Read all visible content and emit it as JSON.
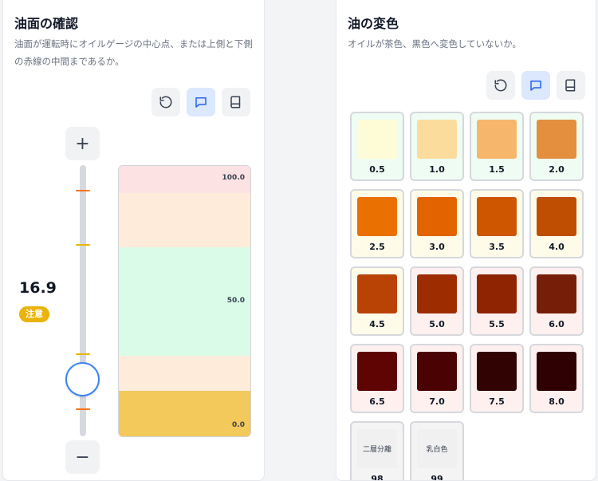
{
  "left": {
    "title": "油面の確認",
    "description": "油面が運転時にオイルゲージの中心点、または上側と下側の赤線の中間まであるか。",
    "value": "16.9",
    "status": "注意",
    "status_color": "#eab308",
    "level_fraction": 0.169,
    "gauge": {
      "top_label": "100.0",
      "mid_label": "50.0",
      "bottom_label": "0.0"
    },
    "stepper": {
      "plus": "+",
      "minus": "−"
    }
  },
  "right": {
    "title": "油の変色",
    "description": "オイルが茶色、黒色へ変色していないか。",
    "swatches": [
      {
        "label": "0.5",
        "color": "#fefcd7",
        "bg": "#eefcf3"
      },
      {
        "label": "1.0",
        "color": "#fbdc9c",
        "bg": "#eefcf3"
      },
      {
        "label": "1.5",
        "color": "#f6b66c",
        "bg": "#eefcf3"
      },
      {
        "label": "2.0",
        "color": "#e38f3d",
        "bg": "#eefcf3"
      },
      {
        "label": "2.5",
        "color": "#ea7002",
        "bg": "#fefbe9"
      },
      {
        "label": "3.0",
        "color": "#e26300",
        "bg": "#fefbe9"
      },
      {
        "label": "3.5",
        "color": "#cf5600",
        "bg": "#fefbe9"
      },
      {
        "label": "4.0",
        "color": "#bf4e02",
        "bg": "#fefbe9"
      },
      {
        "label": "4.5",
        "color": "#b94304",
        "bg": "#fefbe9"
      },
      {
        "label": "5.0",
        "color": "#9d2c01",
        "bg": "#fdf0ef"
      },
      {
        "label": "5.5",
        "color": "#8e2401",
        "bg": "#fdf0ef"
      },
      {
        "label": "6.0",
        "color": "#771e08",
        "bg": "#fdf0ef"
      },
      {
        "label": "6.5",
        "color": "#5e0504",
        "bg": "#fdf0ef"
      },
      {
        "label": "7.0",
        "color": "#4b0202",
        "bg": "#fdf0ef"
      },
      {
        "label": "7.5",
        "color": "#310303",
        "bg": "#fdf0ef"
      },
      {
        "label": "8.0",
        "color": "#2f0102",
        "bg": "#fdf0ef"
      },
      {
        "label": "98",
        "chip_text": "二層分離",
        "color": "#f0f0f0",
        "bg": "#f4f4f4"
      },
      {
        "label": "99",
        "chip_text": "乳白色",
        "color": "#f0f0f0",
        "bg": "#f4f4f4"
      }
    ]
  },
  "toolbar": {
    "icons": [
      "reset-icon",
      "comment-icon",
      "book-icon"
    ]
  },
  "colors": {
    "accent": "#3b82f6",
    "warning_line": "#f97316",
    "caution_line": "#eab308"
  }
}
